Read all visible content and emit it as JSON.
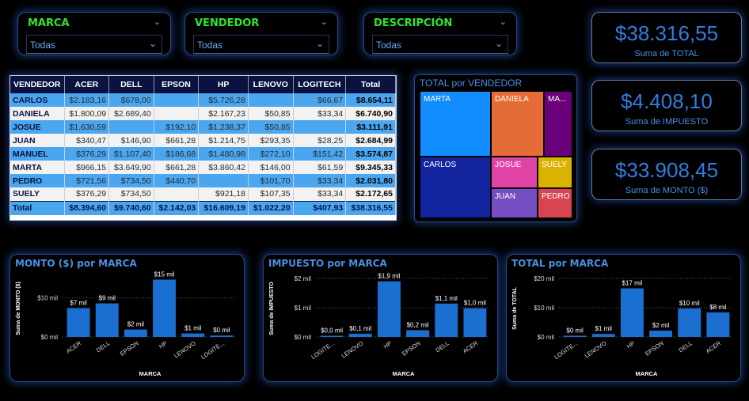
{
  "slicers": [
    {
      "title": "MARCA",
      "value": "Todas"
    },
    {
      "title": "VENDEDOR",
      "value": "Todas"
    },
    {
      "title": "DESCRIPCIÓN",
      "value": "Todas"
    }
  ],
  "kpis": [
    {
      "value": "$38.316,55",
      "label": "Suma de TOTAL"
    },
    {
      "value": "$4.408,10",
      "label": "Suma de IMPUESTO"
    },
    {
      "value": "$33.908,45",
      "label": "Suma de MONTO ($)"
    }
  ],
  "table": {
    "headers": [
      "VENDEDOR",
      "ACER",
      "DELL",
      "EPSON",
      "HP",
      "LENOVO",
      "LOGITECH",
      "Total"
    ],
    "rows": [
      [
        "CARLOS",
        "$2.183,16",
        "$678,00",
        "",
        "$5.726,28",
        "",
        "$66,67",
        "$8.654,11"
      ],
      [
        "DANIELA",
        "$1.800,09",
        "$2.689,40",
        "",
        "$2.167,23",
        "$50,85",
        "$33,34",
        "$6.740,90"
      ],
      [
        "JOSUE",
        "$1.630,59",
        "",
        "$192,10",
        "$1.238,37",
        "$50,85",
        "",
        "$3.111,91"
      ],
      [
        "JUAN",
        "$340,47",
        "$146,90",
        "$661,28",
        "$1.214,75",
        "$293,35",
        "$28,25",
        "$2.684,99"
      ],
      [
        "MANUEL",
        "$376,29",
        "$1.107,40",
        "$186,68",
        "$1.480,98",
        "$272,10",
        "$151,42",
        "$3.574,87"
      ],
      [
        "MARTA",
        "$966,15",
        "$3.649,90",
        "$661,28",
        "$3.860,42",
        "$146,00",
        "$61,59",
        "$9.345,33"
      ],
      [
        "PEDRO",
        "$721,56",
        "$734,50",
        "$440,70",
        "",
        "$101,70",
        "$33,34",
        "$2.031,80"
      ],
      [
        "SUELY",
        "$376,29",
        "$734,50",
        "",
        "$921,18",
        "$107,35",
        "$33,34",
        "$2.172,65"
      ]
    ],
    "total": [
      "Total",
      "$8.394,60",
      "$9.740,60",
      "$2.142,03",
      "$16.609,19",
      "$1.022,20",
      "$407,93",
      "$38.316,55"
    ]
  },
  "treemap": {
    "title": "TOTAL por VENDEDOR",
    "cells": [
      {
        "label": "MARTA",
        "color": "#118dff"
      },
      {
        "label": "DANIELA",
        "color": "#e66c37"
      },
      {
        "label": "MA...",
        "color": "#6b007b"
      },
      {
        "label": "CARLOS",
        "color": "#12239e"
      },
      {
        "label": "JOSUE",
        "color": "#e044a7"
      },
      {
        "label": "SUELY",
        "color": "#d9b300"
      },
      {
        "label": "JUAN",
        "color": "#744ec2"
      },
      {
        "label": "PEDRO",
        "color": "#d64550"
      }
    ]
  },
  "chart_data": [
    {
      "type": "bar",
      "title": "MONTO ($) por MARCA",
      "xlabel": "MARCA",
      "ylabel": "Suma de MONTO ($)",
      "categories": [
        "ACER",
        "DELL",
        "EPSON",
        "HP",
        "LENOVO",
        "LOGITE..."
      ],
      "values": [
        7.4,
        8.6,
        1.9,
        14.7,
        0.9,
        0.36
      ],
      "data_labels": [
        "$7 mil",
        "$9 mil",
        "$2 mil",
        "$15 mil",
        "$1 mil",
        "$0 mil"
      ],
      "yticks": [
        "$0 mil",
        "$10 mil"
      ],
      "ytick_values": [
        0,
        10
      ],
      "ylim": [
        0,
        15
      ],
      "color": "#1a6fd1"
    },
    {
      "type": "bar",
      "title": "IMPUESTO por MARCA",
      "xlabel": "MARCA",
      "ylabel": "Suma de IMPUESTO",
      "categories": [
        "LOGITE...",
        "LENOVO",
        "HP",
        "EPSON",
        "DELL",
        "ACER"
      ],
      "values": [
        0.04,
        0.11,
        1.9,
        0.23,
        1.14,
        0.98
      ],
      "data_labels": [
        "$0,0 mil",
        "$0,1 mil",
        "$1,9 mil",
        "$0,2 mil",
        "$1,1 mil",
        "$1,0 mil"
      ],
      "yticks": [
        "$0 mil",
        "$1 mil",
        "$2 mil"
      ],
      "ytick_values": [
        0,
        1,
        2
      ],
      "ylim": [
        0,
        2
      ],
      "color": "#1a6fd1"
    },
    {
      "type": "bar",
      "title": "TOTAL por MARCA",
      "xlabel": "MARCA",
      "ylabel": "Suma de TOTAL",
      "categories": [
        "LOGITE...",
        "LENOVO",
        "HP",
        "EPSON",
        "DELL",
        "ACER"
      ],
      "values": [
        0.41,
        1.02,
        16.6,
        2.14,
        9.74,
        8.39
      ],
      "data_labels": [
        "$0 mil",
        "$1 mil",
        "$17 mil",
        "$2 mil",
        "$10 mil",
        "$8 mil"
      ],
      "yticks": [
        "$0 mil",
        "$10 mil",
        "$20 mil"
      ],
      "ytick_values": [
        0,
        10,
        20
      ],
      "ylim": [
        0,
        20
      ],
      "color": "#1a6fd1"
    }
  ]
}
